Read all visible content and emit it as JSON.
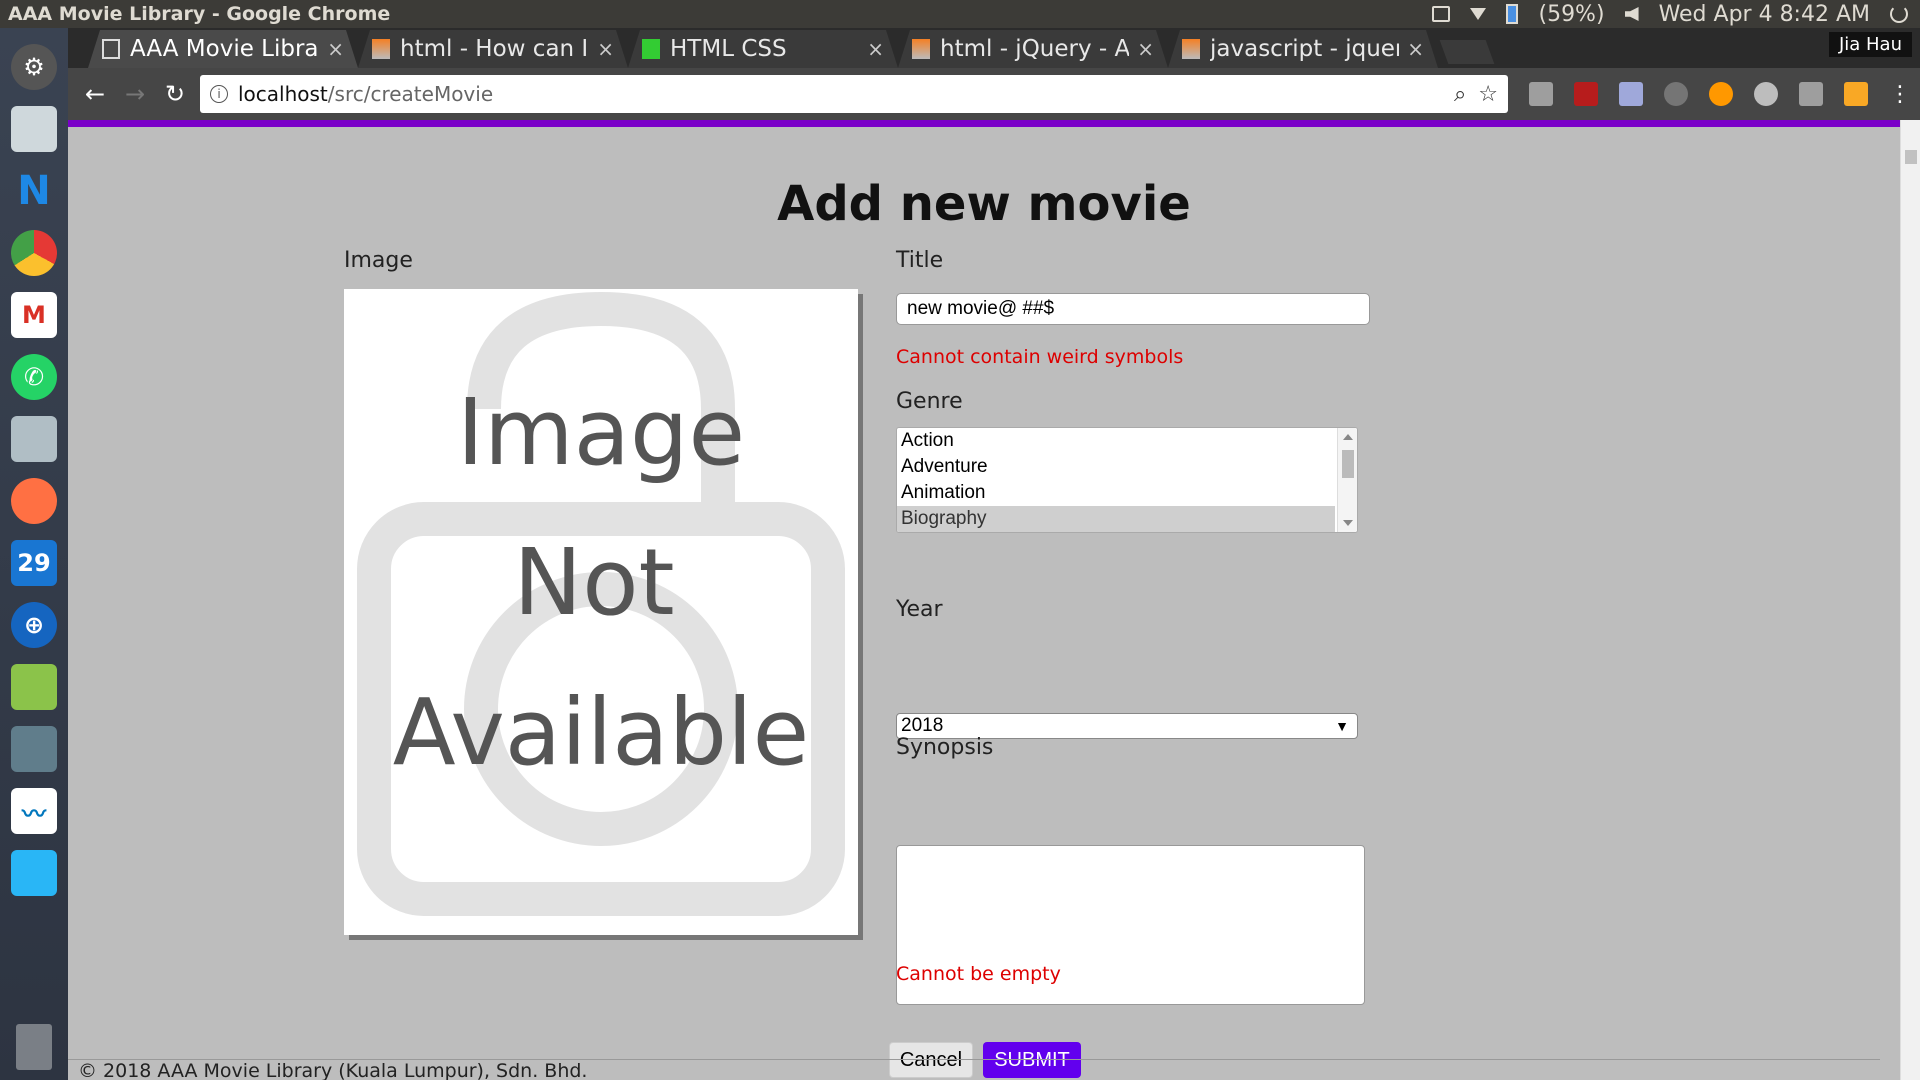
{
  "os": {
    "window_title": "AAA Movie Library - Google Chrome",
    "battery": "(59%)",
    "clock": "Wed Apr  4  8:42 AM",
    "calendar_day": "29"
  },
  "browser": {
    "profile": "Jia Hau",
    "tabs": [
      {
        "label": "AAA Movie Library",
        "icon": "page-icon",
        "active": true
      },
      {
        "label": "html - How can I w",
        "icon": "stackoverflow-icon",
        "active": false
      },
      {
        "label": "HTML CSS",
        "icon": "jsfiddle-icon",
        "active": false
      },
      {
        "label": "html - jQuery - Ap",
        "icon": "stackoverflow-icon",
        "active": false
      },
      {
        "label": "javascript - jquery",
        "icon": "stackoverflow-icon",
        "active": false
      }
    ],
    "url_host": "localhost",
    "url_path": "/src/createMovie"
  },
  "page": {
    "heading": "Add new movie",
    "image_label": "Image",
    "image_placeholder_lines": [
      "Image",
      "Not",
      "Available"
    ],
    "title_label": "Title",
    "title_value": "new movie@ ##$",
    "title_error": "Cannot contain weird symbols",
    "genre_label": "Genre",
    "genres": [
      "Action",
      "Adventure",
      "Animation",
      "Biography"
    ],
    "genre_selected": "Biography",
    "year_label": "Year",
    "year_value": "2018",
    "synopsis_label": "Synopsis",
    "synopsis_error": "Cannot be empty",
    "cancel_label": "Cancel",
    "submit_label": "SUBMIT",
    "footer": "© 2018 AAA Movie Library (Kuala Lumpur), Sdn. Bhd."
  },
  "colors": {
    "accent_purple": "#7a00c8",
    "submit_bg": "#6200ee",
    "error_red": "#dd0000",
    "page_bg": "#bdbdbd"
  }
}
